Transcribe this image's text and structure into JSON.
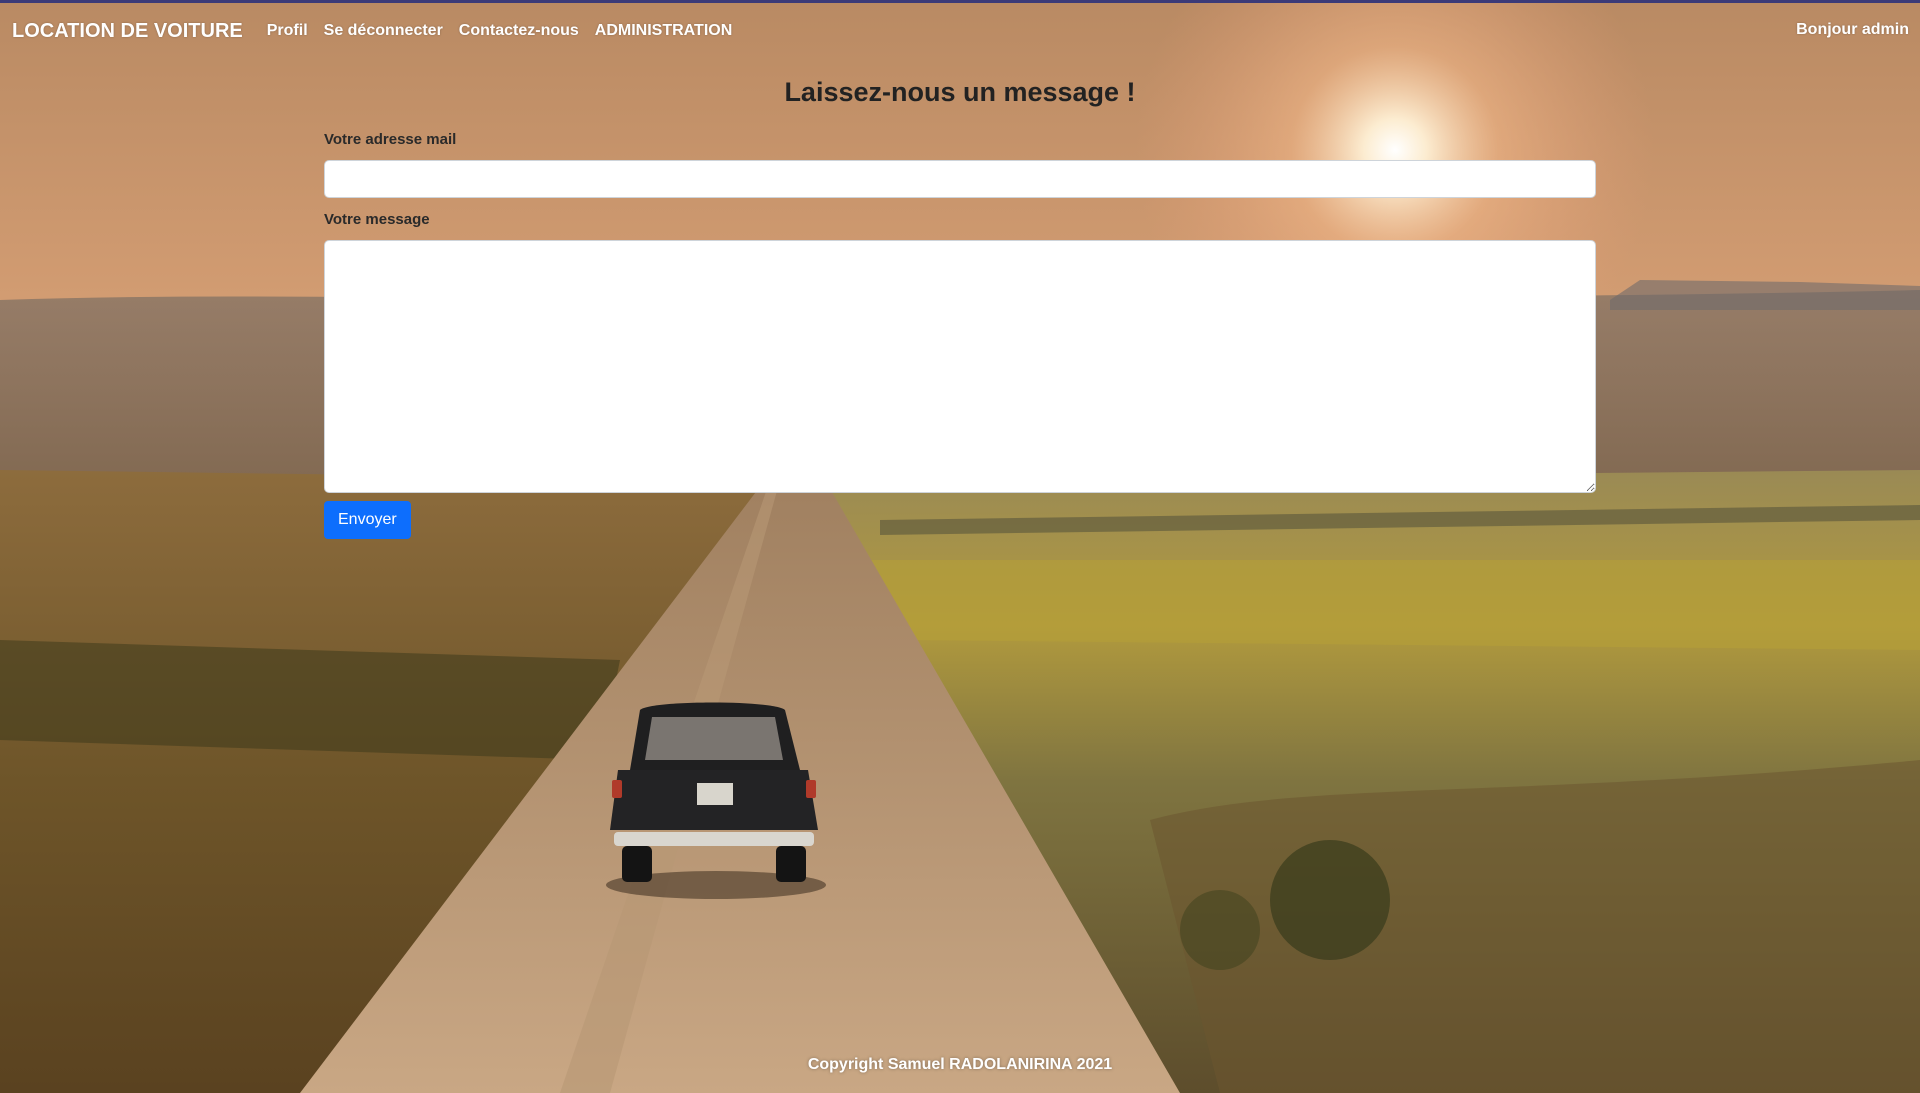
{
  "navbar": {
    "brand": "LOCATION DE VOITURE",
    "links": [
      {
        "label": "Profil"
      },
      {
        "label": "Se déconnecter"
      },
      {
        "label": "Contactez-nous"
      },
      {
        "label": "ADMINISTRATION"
      }
    ],
    "greeting": "Bonjour admin"
  },
  "form": {
    "title": "Laissez-nous un message !",
    "email_label": "Votre adresse mail",
    "email_value": "",
    "message_label": "Votre message",
    "message_value": "",
    "submit_label": "Envoyer"
  },
  "footer": {
    "copyright": "Copyright Samuel RADOLANIRINA 2021"
  },
  "colors": {
    "primary_button": "#0d6efd",
    "topline": "#3b3a78"
  }
}
